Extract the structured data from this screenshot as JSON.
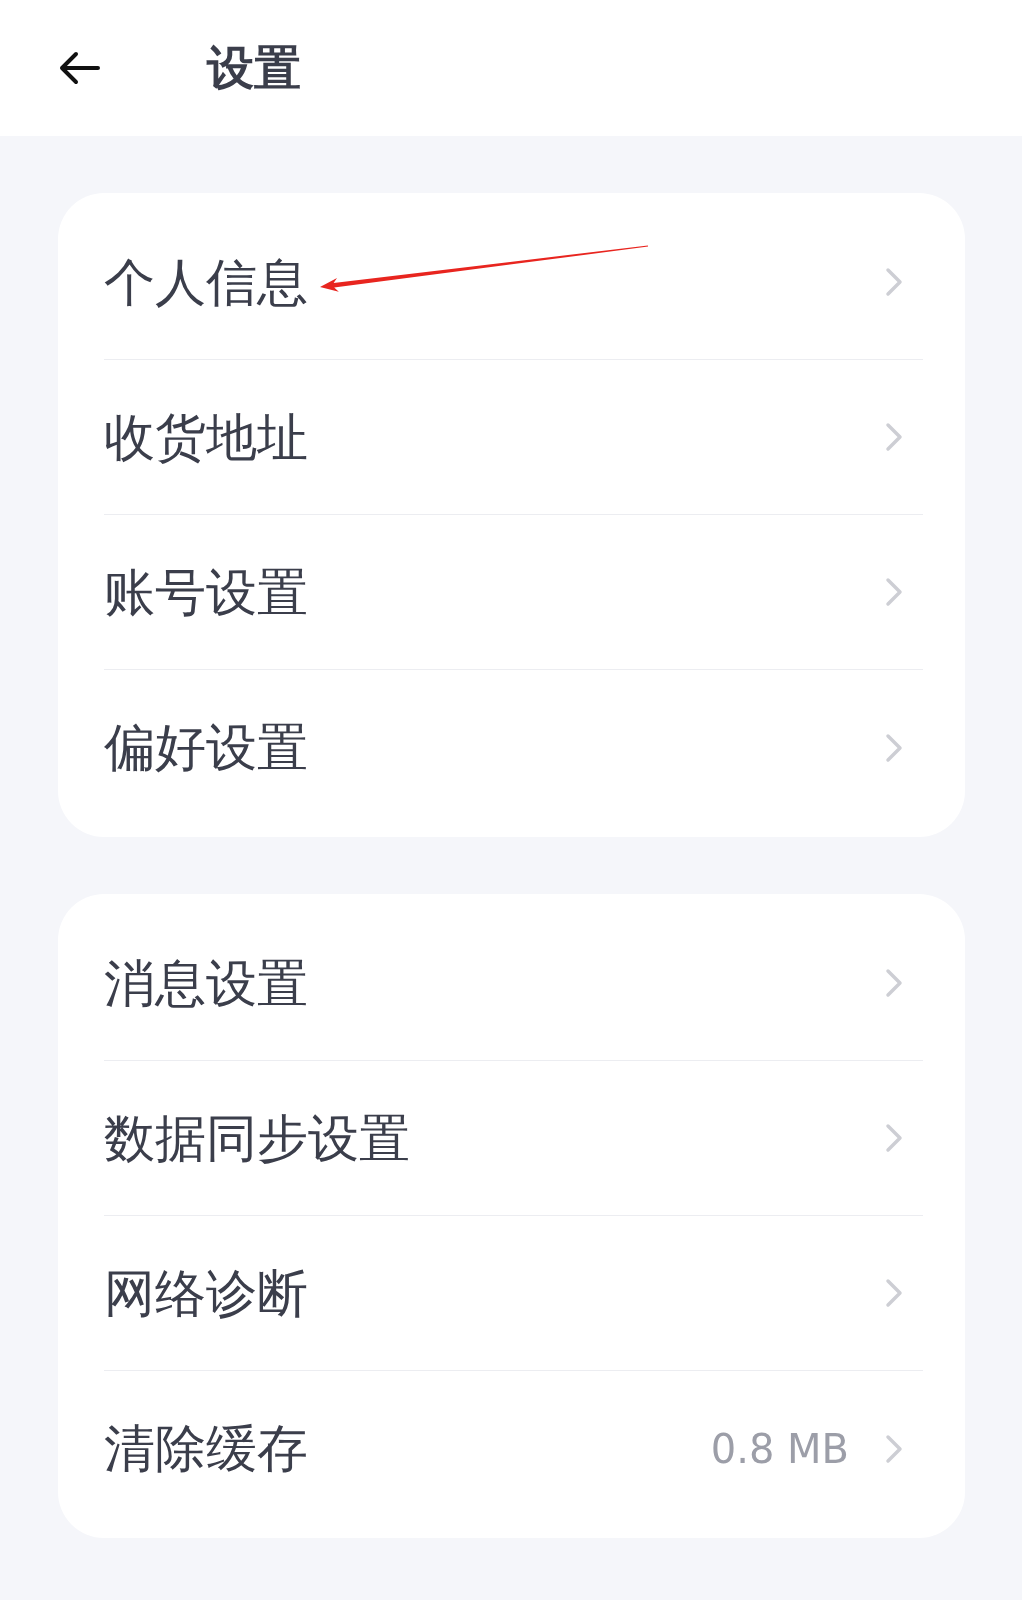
{
  "header": {
    "title": "设置"
  },
  "groups": [
    {
      "items": [
        {
          "label": "个人信息",
          "marked": true
        },
        {
          "label": "收货地址",
          "marked": false
        },
        {
          "label": "账号设置",
          "marked": false
        },
        {
          "label": "偏好设置",
          "marked": false
        }
      ]
    },
    {
      "items": [
        {
          "label": "消息设置",
          "marked": false
        },
        {
          "label": "数据同步设置",
          "marked": false
        },
        {
          "label": "网络诊断",
          "marked": false
        },
        {
          "label": "清除缓存",
          "value": "0.8 MB",
          "marked": false
        }
      ]
    }
  ]
}
